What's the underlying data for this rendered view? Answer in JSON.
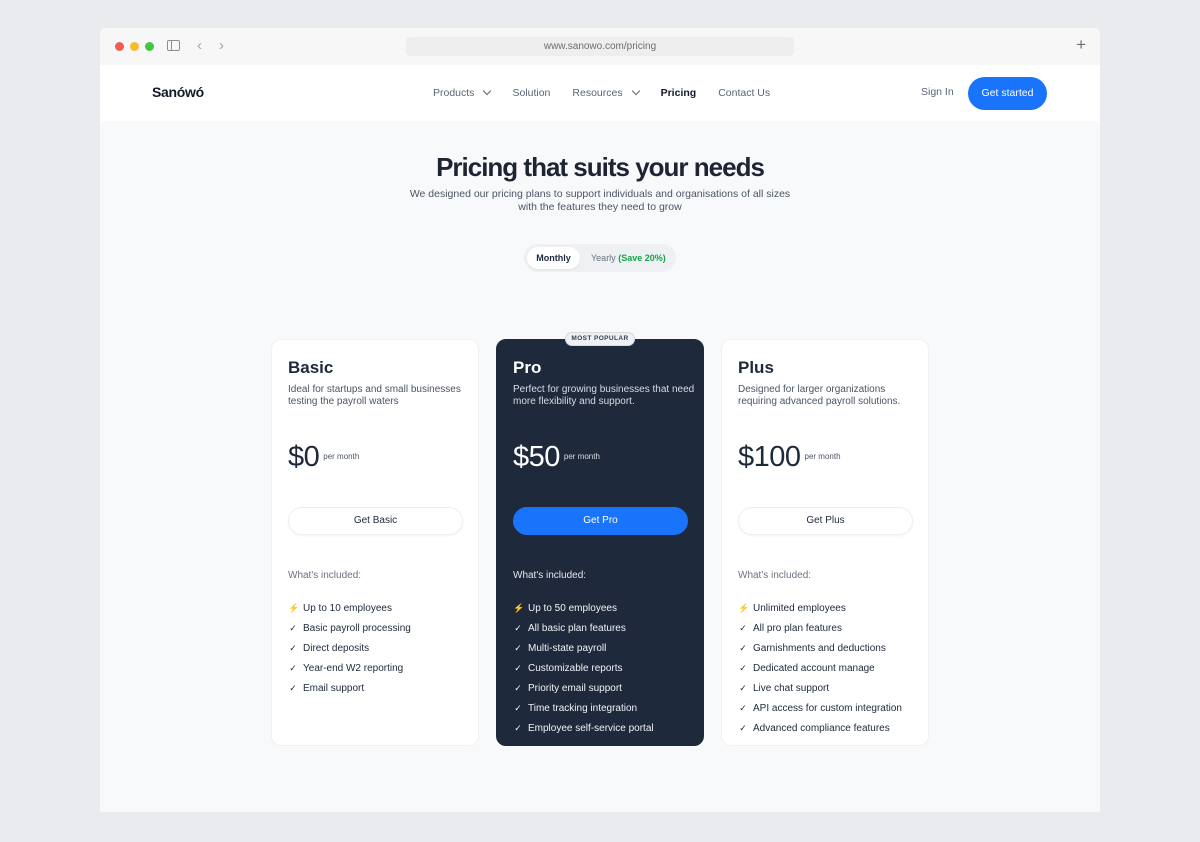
{
  "browser": {
    "url": "www.sanowo.com/pricing",
    "icons": [
      "close-dot",
      "minimize-dot",
      "maximize-dot",
      "sidebar-icon",
      "back-icon",
      "forward-icon",
      "plus-icon"
    ],
    "back_glyph": "‹",
    "forward_glyph": "›",
    "new_tab_glyph": "+"
  },
  "header": {
    "logo": "Sanówó",
    "nav": [
      {
        "label": "Products",
        "has_dropdown": true
      },
      {
        "label": "Solution",
        "has_dropdown": false
      },
      {
        "label": "Resources",
        "has_dropdown": true
      },
      {
        "label": "Pricing",
        "has_dropdown": false,
        "active": true
      },
      {
        "label": "Contact Us",
        "has_dropdown": false
      }
    ],
    "sign_in": "Sign In",
    "cta": "Get started"
  },
  "hero": {
    "title": "Pricing that suits your needs",
    "subtitle_line1": "We designed our pricing plans to support individuals and organisations of all sizes",
    "subtitle_line2": "with the features they need to grow"
  },
  "billing_toggle": {
    "monthly": "Monthly",
    "yearly": "Yearly",
    "yearly_save": "(Save 20%)",
    "selected": "Monthly"
  },
  "badge": "MOST POPULAR",
  "plans": [
    {
      "name": "Basic",
      "description": "Ideal for startups and small businesses testing the payroll waters",
      "price": "$0",
      "period": "per month",
      "button": "Get Basic",
      "included_label": "What's included:",
      "features": [
        {
          "icon": "bolt-icon",
          "glyph": "⚡",
          "text": "Up to 10 employees"
        },
        {
          "icon": "check-icon",
          "glyph": "✓",
          "text": "Basic payroll processing"
        },
        {
          "icon": "check-icon",
          "glyph": "✓",
          "text": "Direct deposits"
        },
        {
          "icon": "check-icon",
          "glyph": "✓",
          "text": "Year-end W2 reporting"
        },
        {
          "icon": "check-icon",
          "glyph": "✓",
          "text": "Email support"
        }
      ]
    },
    {
      "name": "Pro",
      "description": "Perfect for growing businesses that need more flexibility and support.",
      "price": "$50",
      "period": "per month",
      "button": "Get Pro",
      "included_label": "What's included:",
      "features": [
        {
          "icon": "bolt-icon",
          "glyph": "⚡",
          "text": "Up to 50 employees"
        },
        {
          "icon": "check-icon",
          "glyph": "✓",
          "text": "All basic plan features"
        },
        {
          "icon": "check-icon",
          "glyph": "✓",
          "text": "Multi-state payroll"
        },
        {
          "icon": "check-icon",
          "glyph": "✓",
          "text": "Customizable reports"
        },
        {
          "icon": "check-icon",
          "glyph": "✓",
          "text": "Priority email support"
        },
        {
          "icon": "check-icon",
          "glyph": "✓",
          "text": "Time tracking integration"
        },
        {
          "icon": "check-icon",
          "glyph": "✓",
          "text": "Employee self-service portal"
        }
      ]
    },
    {
      "name": "Plus",
      "description": "Designed for larger organizations requiring advanced payroll solutions.",
      "price": "$100",
      "period": "per month",
      "button": "Get Plus",
      "included_label": "What's included:",
      "features": [
        {
          "icon": "bolt-icon",
          "glyph": "⚡",
          "text": "Unlimited employees"
        },
        {
          "icon": "check-icon",
          "glyph": "✓",
          "text": "All pro plan features"
        },
        {
          "icon": "check-icon",
          "glyph": "✓",
          "text": "Garnishments and deductions"
        },
        {
          "icon": "check-icon",
          "glyph": "✓",
          "text": "Dedicated account manage"
        },
        {
          "icon": "check-icon",
          "glyph": "✓",
          "text": "Live chat support"
        },
        {
          "icon": "check-icon",
          "glyph": "✓",
          "text": "API access for custom integration"
        },
        {
          "icon": "check-icon",
          "glyph": "✓",
          "text": "Advanced compliance features"
        }
      ]
    }
  ],
  "colors": {
    "accent": "#1a73fb",
    "dark_card": "#1e293b",
    "save_green": "#16a34a"
  }
}
